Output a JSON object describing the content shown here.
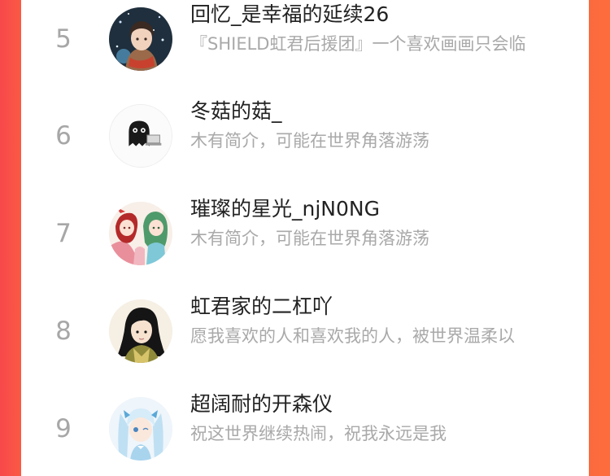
{
  "colors": {
    "background_left": "#f8484a",
    "background_right": "#fc6d3b",
    "panel": "#ffffff",
    "rank_text": "#a7a7a7",
    "name_text": "#222222",
    "desc_text": "#a9a9a9"
  },
  "ranking": [
    {
      "rank": "5",
      "name": "回忆_是幸福的延续26",
      "desc": "『SHIELD虹君后援团』一个喜欢画画只会临",
      "avatar_icon": "anime-boy-scarf-avatar-icon"
    },
    {
      "rank": "6",
      "name": "冬菇的菇_",
      "desc": "木有简介，可能在世界角落游荡",
      "avatar_icon": "black-ghost-laptop-avatar-icon"
    },
    {
      "rank": "7",
      "name": "璀璨的星光_njN0NG",
      "desc": "木有简介，可能在世界角落游荡",
      "avatar_icon": "two-anime-girls-avatar-icon"
    },
    {
      "rank": "8",
      "name": "虹君家的二杠吖",
      "desc": "愿我喜欢的人和喜欢我的人，被世界温柔以",
      "avatar_icon": "anime-boy-black-hair-avatar-icon"
    },
    {
      "rank": "9",
      "name": "超阔耐的开森仪",
      "desc": "祝这世界继续热闹，祝我永远是我",
      "avatar_icon": "anime-girl-blue-twintails-avatar-icon"
    }
  ]
}
